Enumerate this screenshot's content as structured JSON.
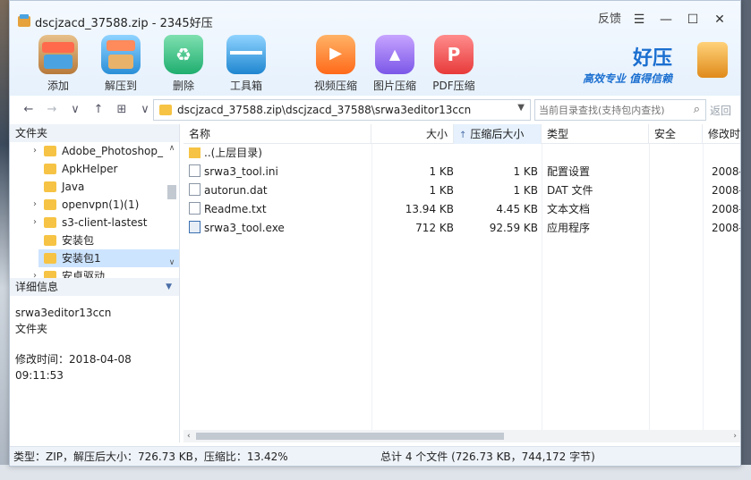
{
  "window": {
    "title": "dscjzacd_37588.zip - 2345好压",
    "feedback_label": "反馈",
    "menu_glyph": "☰",
    "min_glyph": "—",
    "max_glyph": "☐",
    "close_glyph": "✕"
  },
  "toolbar": {
    "left": [
      {
        "label": "添加",
        "icon": "box-icon"
      },
      {
        "label": "解压到",
        "icon": "extract-icon"
      },
      {
        "label": "删除",
        "icon": "recycle-icon"
      },
      {
        "label": "工具箱",
        "icon": "toolbox-icon"
      }
    ],
    "right": [
      {
        "label": "视频压缩",
        "icon": "video-icon"
      },
      {
        "label": "图片压缩",
        "icon": "picture-icon"
      },
      {
        "label": "PDF压缩",
        "icon": "pdf-icon"
      }
    ]
  },
  "brand": {
    "name": "好压",
    "slogan": "高效专业  值得信赖"
  },
  "addressbar": {
    "back": "←",
    "forward": "→",
    "history": "∨",
    "up": "↑",
    "view": "⊞",
    "view_dd": "∨",
    "path": "dscjzacd_37588.zip\\dscjzacd_37588\\srwa3editor13ccn",
    "dropdown": "▼",
    "search_placeholder": "当前目录查找(支持包内查找)",
    "search_icon": "⌕",
    "return_label": "返回"
  },
  "folder_pane": {
    "header": "文件夹",
    "items": [
      {
        "label": "Adobe_Photoshop_",
        "arrow": "›"
      },
      {
        "label": "ApkHelper",
        "arrow": ""
      },
      {
        "label": "Java",
        "arrow": ""
      },
      {
        "label": "openvpn(1)(1)",
        "arrow": "›"
      },
      {
        "label": "s3-client-lastest",
        "arrow": "›"
      },
      {
        "label": "安装包",
        "arrow": ""
      },
      {
        "label": "安装包1",
        "arrow": ""
      },
      {
        "label": "安卓驱动",
        "arrow": "›"
      }
    ],
    "scroll_up": "∧",
    "scroll_down": "∨"
  },
  "details": {
    "header": "详细信息",
    "toggle": "▼",
    "name": "srwa3editor13ccn",
    "kind": "文件夹",
    "modified": "修改时间：2018-04-08 09:11:53"
  },
  "file_list": {
    "columns": {
      "name": "名称",
      "size": "大小",
      "csize": "压缩后大小",
      "sort_arrow": "↑",
      "type": "类型",
      "security": "安全",
      "date": "修改时"
    },
    "rows": [
      {
        "name": "..(上层目录)",
        "icon": "folder",
        "size": "",
        "csize": "",
        "type": "",
        "date": ""
      },
      {
        "name": "srwa3_tool.ini",
        "icon": "file",
        "size": "1 KB",
        "csize": "1 KB",
        "type": "配置设置",
        "date": "2008-"
      },
      {
        "name": "autorun.dat",
        "icon": "file",
        "size": "1 KB",
        "csize": "1 KB",
        "type": "DAT 文件",
        "date": "2008-"
      },
      {
        "name": "Readme.txt",
        "icon": "file",
        "size": "13.94 KB",
        "csize": "4.45 KB",
        "type": "文本文档",
        "date": "2008-"
      },
      {
        "name": "srwa3_tool.exe",
        "icon": "exe",
        "size": "712 KB",
        "csize": "92.59 KB",
        "type": "应用程序",
        "date": "2008-"
      }
    ],
    "hscroll_left": "‹",
    "hscroll_right": "›"
  },
  "statusbar": {
    "left": "类型：ZIP，解压后大小：726.73 KB，压缩比：13.42%",
    "right": "总计 4 个文件 (726.73 KB，744,172 字节)"
  }
}
